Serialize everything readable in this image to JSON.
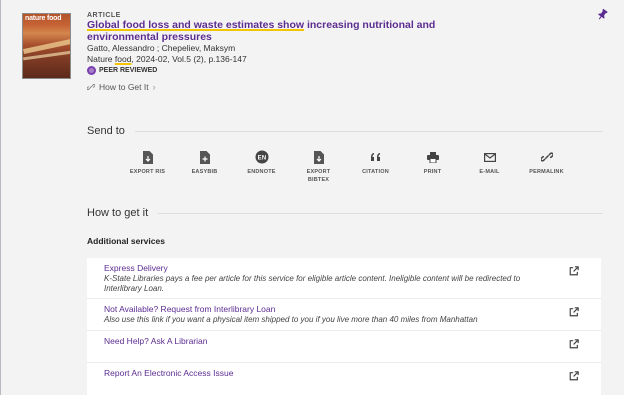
{
  "record": {
    "cover_title": "nature food",
    "doc_type": "ARTICLE",
    "title_highlighted": "Global food loss and waste estimates show",
    "title_rest": " increasing nutritional and environmental pressures",
    "authors": "Gatto, Alessandro ; Chepeliev, Maksym",
    "source_prefix": "Nature ",
    "source_journal": "food",
    "source_suffix": ", 2024-02, Vol.5 (2), p.136-147",
    "peer_reviewed": "PEER REVIEWED",
    "how_to_get_it_link": "How to Get It",
    "colors": {
      "accent": "#5c2d91",
      "highlight": "#f2c500"
    }
  },
  "send_to": {
    "heading": "Send to",
    "actions": [
      {
        "label": "EXPORT RIS",
        "icon": "file-export-icon"
      },
      {
        "label": "EASYBIB",
        "icon": "file-plus-icon"
      },
      {
        "label": "ENDNOTE",
        "icon": "endnote-icon",
        "badge": "EN"
      },
      {
        "label": "EXPORT BIBTEX",
        "icon": "file-export-icon"
      },
      {
        "label": "CITATION",
        "icon": "quote-icon"
      },
      {
        "label": "PRINT",
        "icon": "printer-icon"
      },
      {
        "label": "E-MAIL",
        "icon": "mail-icon"
      },
      {
        "label": "PERMALINK",
        "icon": "link-icon"
      }
    ]
  },
  "how_to_get_it": {
    "heading": "How to get it",
    "additional_services": "Additional services",
    "services": [
      {
        "name": "Express Delivery",
        "description": "K-State Libraries pays a fee per article for this service for eligible article content. Ineligible content will be redirected to Interlibrary Loan."
      },
      {
        "name": "Not Available? Request from Interlibrary Loan",
        "description": "Also use this link if you want a physical item shipped to you if you live more than 40 miles from Manhattan"
      },
      {
        "name": "Need Help? Ask A Librarian",
        "description": ""
      },
      {
        "name": "Report An Electronic Access Issue",
        "description": ""
      }
    ]
  }
}
